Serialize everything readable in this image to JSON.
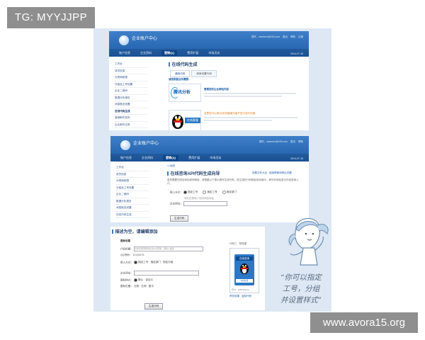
{
  "overlay": {
    "tag": "TG: MYYJJPP",
    "watermark": "www.avora15.org"
  },
  "header": {
    "app_title": "企业账户中心",
    "user_info": [
      "您好，wwwxxx@163.com",
      "退出",
      "帮助",
      "注销"
    ],
    "date": "2014-07-16",
    "nav": [
      "账户信息",
      "企业资料",
      "营销QQ",
      "费用扩展",
      "市场活动"
    ],
    "nav_active_index": 2
  },
  "sidebar": {
    "items": [
      "工作台",
      "成员信息",
      "分类和权限",
      "分组及工号设置",
      "企业二维码",
      "数据分析报告",
      "消息推送设置",
      "在线代码生成",
      "营销邮件发布",
      "企业邮件记录"
    ],
    "active_index": 7
  },
  "panel1": {
    "section_title": "在线代码生成",
    "tabs": [
      "通用代码",
      "商家设置代码"
    ],
    "subhead": "请您根据业务需要：",
    "card1_brand": "腾讯分析",
    "card1_title": "管理您的企业网站内容",
    "card2_title": "在线客服",
    "card2_line": "这里您可以用QQ在线客服与客户进行实时沟通"
  },
  "panel2": {
    "breadcrumb": "<<返回",
    "section_title": "在线咨询API代码生成向导",
    "help_link": "查看文件大全 · 使用帮助和常见问题",
    "desc": "若您需要在网站添加咨询按钮，请根据以下提示操作生成代码，将生成的代码粘贴到页面中，即可在网站显示在线咨询入口。",
    "label_access": "接入方式：",
    "options_access": [
      "指定工号",
      "指定工号",
      "指定部门"
    ],
    "label_site": "企业网址：",
    "site_hint": "请在这里填入您的网站地址",
    "button": "生成代码"
  },
  "panel3": {
    "section_title": "描述为空，请编辑添加",
    "group_title": "图标设置",
    "fields": [
      {
        "label": "代码标题：",
        "value": "为你来使用我的企业QQ营销，请输入描述"
      },
      {
        "label": "QQ号码：",
        "value": "12345678"
      },
      {
        "label": "接入方式：",
        "value": "指定工号 · 指定部门 · 指定分组"
      },
      {
        "label": "企业网址：",
        "value": ""
      },
      {
        "label": "图标样式：",
        "value": "默认 · 自定义"
      },
      {
        "label": "图标位置：",
        "value": "左侧 · 右侧 · 居中"
      }
    ],
    "preview_label": "代码三 · 预览图",
    "qq_card_top": "在线咨询",
    "qq_card_bottom": "QQ交谈",
    "size_text": "尺寸：100×120 px",
    "preview_link": "预览效果 · 复制代码",
    "button": "生成代码"
  },
  "mascot": {
    "quote_lines": [
      "“你可以指定",
      "工号，分组",
      "并设置样式”"
    ]
  }
}
